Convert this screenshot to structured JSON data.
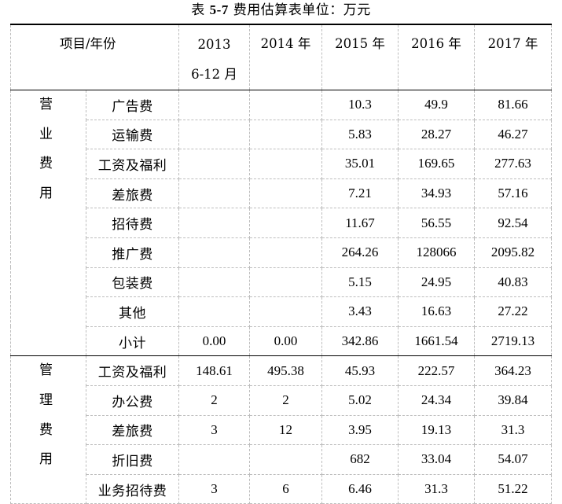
{
  "caption": {
    "prefix": "表 ",
    "number": "5-7",
    "text": " 费用估算表单位：万元"
  },
  "table": {
    "header": {
      "corner": "项目/年份",
      "y2013_line1": "2013",
      "y2013_line2": "6-12 月",
      "y2014": "2014 年",
      "y2015": "2015 年",
      "y2016": "2016 年",
      "y2017": "2017 年"
    },
    "sections": [
      {
        "category_chars": [
          "营",
          "业",
          "费",
          "用"
        ],
        "rows": [
          {
            "item": "广告费",
            "y2013": "",
            "y2014": "",
            "y2015": "10.3",
            "y2016": "49.9",
            "y2017": "81.66"
          },
          {
            "item": "运输费",
            "y2013": "",
            "y2014": "",
            "y2015": "5.83",
            "y2016": "28.27",
            "y2017": "46.27"
          },
          {
            "item": "工资及福利",
            "y2013": "",
            "y2014": "",
            "y2015": "35.01",
            "y2016": "169.65",
            "y2017": "277.63"
          },
          {
            "item": "差旅费",
            "y2013": "",
            "y2014": "",
            "y2015": "7.21",
            "y2016": "34.93",
            "y2017": "57.16"
          },
          {
            "item": "招待费",
            "y2013": "",
            "y2014": "",
            "y2015": "11.67",
            "y2016": "56.55",
            "y2017": "92.54"
          },
          {
            "item": "推广费",
            "y2013": "",
            "y2014": "",
            "y2015": "264.26",
            "y2016": "128066",
            "y2017": "2095.82"
          },
          {
            "item": "包装费",
            "y2013": "",
            "y2014": "",
            "y2015": "5.15",
            "y2016": "24.95",
            "y2017": "40.83"
          },
          {
            "item": "其他",
            "y2013": "",
            "y2014": "",
            "y2015": "3.43",
            "y2016": "16.63",
            "y2017": "27.22"
          },
          {
            "item": "小计",
            "y2013": "0.00",
            "y2014": "0.00",
            "y2015": "342.86",
            "y2016": "1661.54",
            "y2017": "2719.13"
          }
        ]
      },
      {
        "category_chars": [
          "管",
          "理",
          "费",
          "用"
        ],
        "rows": [
          {
            "item": "工资及福利",
            "y2013": "148.61",
            "y2014": "495.38",
            "y2015": "45.93",
            "y2016": "222.57",
            "y2017": "364.23"
          },
          {
            "item": "办公费",
            "y2013": "2",
            "y2014": "2",
            "y2015": "5.02",
            "y2016": "24.34",
            "y2017": "39.84"
          },
          {
            "item": "差旅费",
            "y2013": "3",
            "y2014": "12",
            "y2015": "3.95",
            "y2016": "19.13",
            "y2017": "31.3"
          },
          {
            "item": "折旧费",
            "y2013": "",
            "y2014": "",
            "y2015": "682",
            "y2016": "33.04",
            "y2017": "54.07"
          },
          {
            "item": "业务招待费",
            "y2013": "3",
            "y2014": "6",
            "y2015": "6.46",
            "y2016": "31.3",
            "y2017": "51.22"
          }
        ]
      }
    ]
  }
}
